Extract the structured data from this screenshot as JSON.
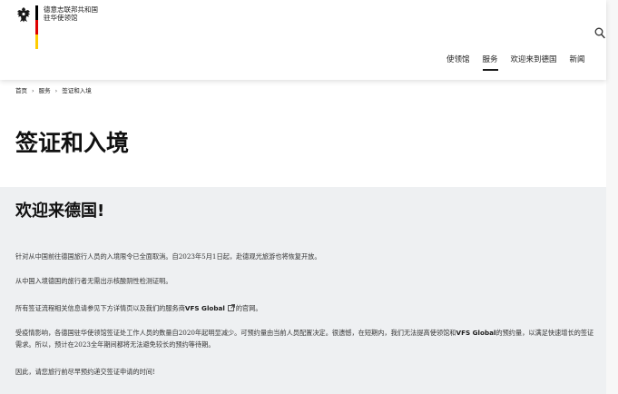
{
  "header": {
    "org_name_line1": "德意志联邦共和国",
    "org_name_line2": "驻华使领馆",
    "flag_colors": [
      "#000000",
      "#dd0000",
      "#ffcc00"
    ],
    "nav": [
      {
        "label": "使领馆",
        "active": false
      },
      {
        "label": "服务",
        "active": true
      },
      {
        "label": "欢迎来到德国",
        "active": false
      },
      {
        "label": "新闻",
        "active": false
      }
    ],
    "icons": {
      "logo": "eagle-icon",
      "search": "search-icon"
    }
  },
  "breadcrumb": [
    "首页",
    "服务",
    "签证和入境"
  ],
  "page_title": "签证和入境",
  "content": {
    "heading": "欢迎来德国!",
    "p1": "针对从中国前往德国旅行人员的入境限令已全面取消。自2023年5月1日起，赴德观光旅游也将恢复开放。",
    "p2": "从中国入境德国的旅行者无需出示核酸阴性检测证明。",
    "p3_before": "所有签证流程相关信息请参见下方详情页以及我们的服务商",
    "p3_link": "VFS Global",
    "p3_after": "的官网。",
    "p4_before": "受疫情影响，各德国驻华使领馆签证处工作人员的数量自2020年起明显减少。可预约量由当前人员配置决定。很遗憾，在短期内，我们无法提高使领馆和",
    "p4_link": "VFS Global",
    "p4_after": "的预约量，以满足快速增长的签证需求。所以，预计在2023全年期间都将无法避免较长的预约等待期。",
    "p5": "因此，请您旅行前尽早预约递交签证申请的时间!"
  },
  "colors": {
    "panel_bg": "#eef0f2",
    "text": "#1a1a1a"
  }
}
